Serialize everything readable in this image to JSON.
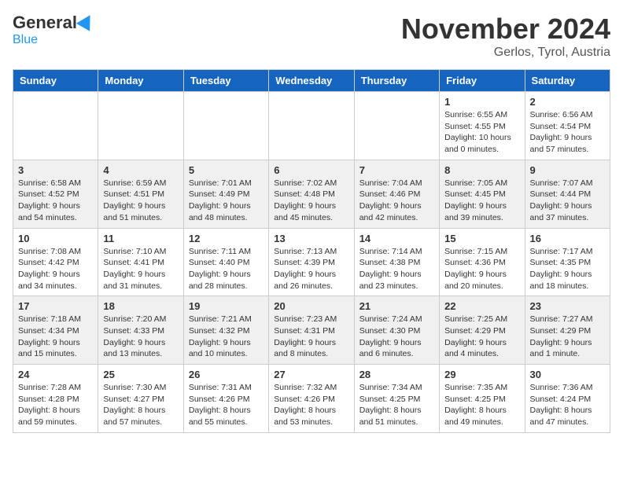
{
  "header": {
    "logo_general": "General",
    "logo_blue": "Blue",
    "month_title": "November 2024",
    "location": "Gerlos, Tyrol, Austria"
  },
  "weekdays": [
    "Sunday",
    "Monday",
    "Tuesday",
    "Wednesday",
    "Thursday",
    "Friday",
    "Saturday"
  ],
  "weeks": [
    [
      {
        "day": "",
        "info": ""
      },
      {
        "day": "",
        "info": ""
      },
      {
        "day": "",
        "info": ""
      },
      {
        "day": "",
        "info": ""
      },
      {
        "day": "",
        "info": ""
      },
      {
        "day": "1",
        "info": "Sunrise: 6:55 AM\nSunset: 4:55 PM\nDaylight: 10 hours\nand 0 minutes."
      },
      {
        "day": "2",
        "info": "Sunrise: 6:56 AM\nSunset: 4:54 PM\nDaylight: 9 hours\nand 57 minutes."
      }
    ],
    [
      {
        "day": "3",
        "info": "Sunrise: 6:58 AM\nSunset: 4:52 PM\nDaylight: 9 hours\nand 54 minutes."
      },
      {
        "day": "4",
        "info": "Sunrise: 6:59 AM\nSunset: 4:51 PM\nDaylight: 9 hours\nand 51 minutes."
      },
      {
        "day": "5",
        "info": "Sunrise: 7:01 AM\nSunset: 4:49 PM\nDaylight: 9 hours\nand 48 minutes."
      },
      {
        "day": "6",
        "info": "Sunrise: 7:02 AM\nSunset: 4:48 PM\nDaylight: 9 hours\nand 45 minutes."
      },
      {
        "day": "7",
        "info": "Sunrise: 7:04 AM\nSunset: 4:46 PM\nDaylight: 9 hours\nand 42 minutes."
      },
      {
        "day": "8",
        "info": "Sunrise: 7:05 AM\nSunset: 4:45 PM\nDaylight: 9 hours\nand 39 minutes."
      },
      {
        "day": "9",
        "info": "Sunrise: 7:07 AM\nSunset: 4:44 PM\nDaylight: 9 hours\nand 37 minutes."
      }
    ],
    [
      {
        "day": "10",
        "info": "Sunrise: 7:08 AM\nSunset: 4:42 PM\nDaylight: 9 hours\nand 34 minutes."
      },
      {
        "day": "11",
        "info": "Sunrise: 7:10 AM\nSunset: 4:41 PM\nDaylight: 9 hours\nand 31 minutes."
      },
      {
        "day": "12",
        "info": "Sunrise: 7:11 AM\nSunset: 4:40 PM\nDaylight: 9 hours\nand 28 minutes."
      },
      {
        "day": "13",
        "info": "Sunrise: 7:13 AM\nSunset: 4:39 PM\nDaylight: 9 hours\nand 26 minutes."
      },
      {
        "day": "14",
        "info": "Sunrise: 7:14 AM\nSunset: 4:38 PM\nDaylight: 9 hours\nand 23 minutes."
      },
      {
        "day": "15",
        "info": "Sunrise: 7:15 AM\nSunset: 4:36 PM\nDaylight: 9 hours\nand 20 minutes."
      },
      {
        "day": "16",
        "info": "Sunrise: 7:17 AM\nSunset: 4:35 PM\nDaylight: 9 hours\nand 18 minutes."
      }
    ],
    [
      {
        "day": "17",
        "info": "Sunrise: 7:18 AM\nSunset: 4:34 PM\nDaylight: 9 hours\nand 15 minutes."
      },
      {
        "day": "18",
        "info": "Sunrise: 7:20 AM\nSunset: 4:33 PM\nDaylight: 9 hours\nand 13 minutes."
      },
      {
        "day": "19",
        "info": "Sunrise: 7:21 AM\nSunset: 4:32 PM\nDaylight: 9 hours\nand 10 minutes."
      },
      {
        "day": "20",
        "info": "Sunrise: 7:23 AM\nSunset: 4:31 PM\nDaylight: 9 hours\nand 8 minutes."
      },
      {
        "day": "21",
        "info": "Sunrise: 7:24 AM\nSunset: 4:30 PM\nDaylight: 9 hours\nand 6 minutes."
      },
      {
        "day": "22",
        "info": "Sunrise: 7:25 AM\nSunset: 4:29 PM\nDaylight: 9 hours\nand 4 minutes."
      },
      {
        "day": "23",
        "info": "Sunrise: 7:27 AM\nSunset: 4:29 PM\nDaylight: 9 hours\nand 1 minute."
      }
    ],
    [
      {
        "day": "24",
        "info": "Sunrise: 7:28 AM\nSunset: 4:28 PM\nDaylight: 8 hours\nand 59 minutes."
      },
      {
        "day": "25",
        "info": "Sunrise: 7:30 AM\nSunset: 4:27 PM\nDaylight: 8 hours\nand 57 minutes."
      },
      {
        "day": "26",
        "info": "Sunrise: 7:31 AM\nSunset: 4:26 PM\nDaylight: 8 hours\nand 55 minutes."
      },
      {
        "day": "27",
        "info": "Sunrise: 7:32 AM\nSunset: 4:26 PM\nDaylight: 8 hours\nand 53 minutes."
      },
      {
        "day": "28",
        "info": "Sunrise: 7:34 AM\nSunset: 4:25 PM\nDaylight: 8 hours\nand 51 minutes."
      },
      {
        "day": "29",
        "info": "Sunrise: 7:35 AM\nSunset: 4:25 PM\nDaylight: 8 hours\nand 49 minutes."
      },
      {
        "day": "30",
        "info": "Sunrise: 7:36 AM\nSunset: 4:24 PM\nDaylight: 8 hours\nand 47 minutes."
      }
    ]
  ]
}
